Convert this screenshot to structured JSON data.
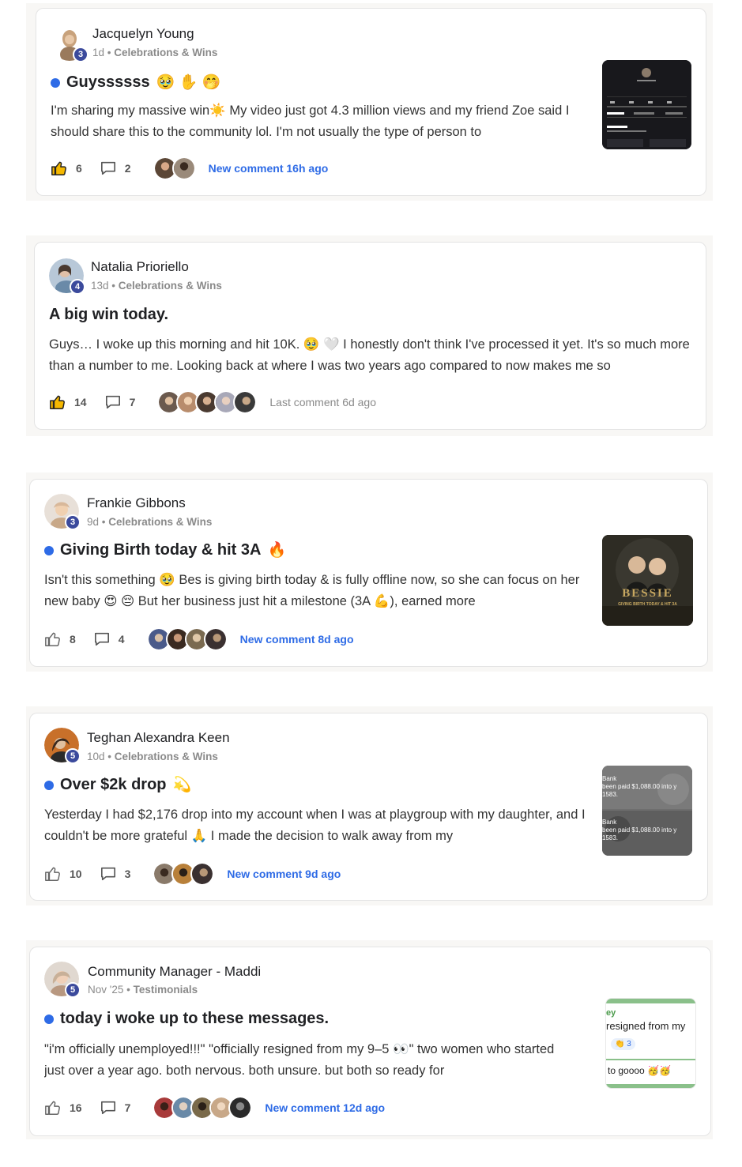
{
  "posts": [
    {
      "author": "Jacquelyn Young",
      "level": "3",
      "time": "1d",
      "separator": " • ",
      "category": "Celebrations & Wins",
      "title": "Guyssssss",
      "title_emojis": "🥹 ✋ 🤭",
      "unread": true,
      "body": "I'm sharing my massive win☀️ My video just got 4.3 million views and my friend Zoe said I should share this to the community lol. I'm not usually the type of person to",
      "likes": "6",
      "comments": "2",
      "comment_text": "New comment 16h ago",
      "comment_status": "new",
      "avatar_color": "#c8a27c",
      "commenter_colors": [
        "#5b4636",
        "#9a8a7a"
      ],
      "thumb_theme": "dark-stats"
    },
    {
      "author": "Natalia Prioriello",
      "level": "4",
      "time": "13d",
      "separator": " • ",
      "category": "Celebrations & Wins",
      "title": "A big win today.",
      "title_emojis": "",
      "unread": false,
      "body": "Guys… I woke up this morning and hit 10K. 🥹 🤍 I honestly don't think I've processed it yet. It's so much more than a number to me. Looking back at where I was two years ago compared to now makes me so",
      "likes": "14",
      "comments": "7",
      "comment_text": "Last comment 6d ago",
      "comment_status": "last",
      "avatar_color": "#8aa0b8",
      "commenter_colors": [
        "#6b5a4e",
        "#b88c6c",
        "#4a3a30",
        "#a8a8b8",
        "#3a3a3a"
      ],
      "thumb_theme": ""
    },
    {
      "author": "Frankie Gibbons",
      "level": "3",
      "time": "9d",
      "separator": " • ",
      "category": "Celebrations & Wins",
      "title": "Giving Birth today & hit 3A",
      "title_emojis": "🔥",
      "unread": true,
      "body": "Isn't this something 🥹 Bes is giving birth today & is fully offline now, so she can focus on her new baby 😍 😔 But her business just hit a milestone (3A 💪), earned more",
      "likes": "8",
      "comments": "4",
      "comment_text": "New comment 8d ago",
      "comment_status": "new",
      "avatar_color": "#d8b89a",
      "commenter_colors": [
        "#4a5a8a",
        "#3a2a20",
        "#7a6a50",
        "#3a3030"
      ],
      "thumb_theme": "bessie",
      "thumb_title": "BESSIE",
      "thumb_sub": "GIVING BIRTH TODAY & HIT 3A"
    },
    {
      "author": "Teghan Alexandra Keen",
      "level": "5",
      "time": "10d",
      "separator": " • ",
      "category": "Celebrations & Wins",
      "title": "Over $2k drop",
      "title_emojis": "💫",
      "unread": true,
      "body": "Yesterday I had $2,176 drop into my account when I was at playgroup with my daughter, and I couldn't be more grateful 🙏 I made the decision to walk away from my",
      "likes": "10",
      "comments": "3",
      "comment_text": "New comment 9d ago",
      "comment_status": "new",
      "avatar_color": "#6a4a3a",
      "commenter_colors": [
        "#8a7a6a",
        "#b8803a",
        "#3a3030"
      ],
      "thumb_theme": "bank",
      "thumb_line1": "Bank",
      "thumb_line2": "been paid $1,088.00 into y",
      "thumb_line3": "1583."
    },
    {
      "author": "Community Manager - Maddi",
      "level": "5",
      "time": "Nov '25",
      "separator": " • ",
      "category": "Testimonials",
      "title": "today i woke up to these messages.",
      "title_emojis": "",
      "unread": true,
      "body": "\"i'm officially unemployed!!!\" \"officially resigned from my 9–5 👀\" two women who started just over a year ago. both nervous. both unsure. but both so ready for",
      "likes": "16",
      "comments": "7",
      "comment_text": "New comment 12d ago",
      "comment_status": "new",
      "avatar_color": "#c8b098",
      "commenter_colors": [
        "#a83a3a",
        "#6a8aa8",
        "#7a6a4a",
        "#c8a888",
        "#2a2a2a"
      ],
      "thumb_theme": "chat",
      "thumb_line1": "ey",
      "thumb_line2": "resigned from my",
      "thumb_reaction": "👏 3",
      "thumb_line3": "to goooo 🥳🥳"
    }
  ]
}
